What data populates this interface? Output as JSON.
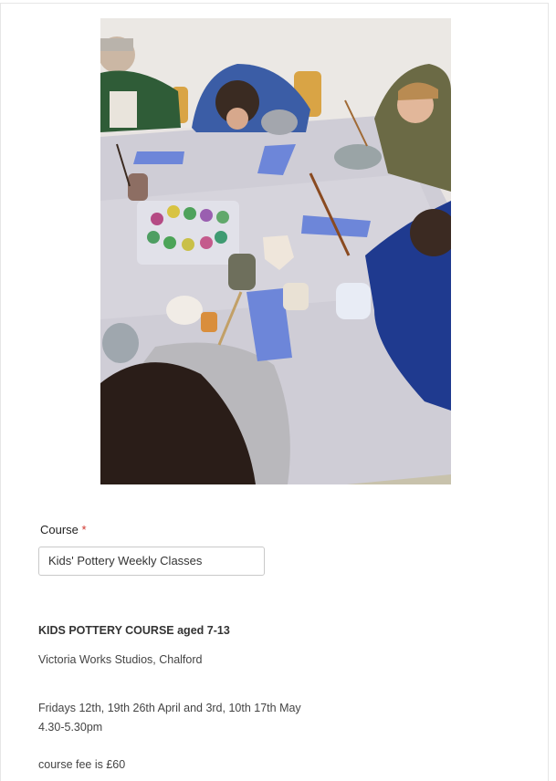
{
  "form": {
    "image_alt": "Children painting pottery at a table",
    "course_label": "Course",
    "required_marker": "*",
    "course_value": "Kids' Pottery Weekly Classes"
  },
  "description": {
    "title": "KIDS  POTTERY COURSE aged 7-13",
    "location": "Victoria Works Studios, Chalford",
    "dates": "Fridays 12th, 19th 26th April and 3rd, 10th 17th May",
    "time": "4.30-5.30pm",
    "fee": "course fee is £60"
  },
  "colors": {
    "required": "#d0342c",
    "table_cloth": "#cfcdd6",
    "blue_mat": "#6d86d9"
  }
}
